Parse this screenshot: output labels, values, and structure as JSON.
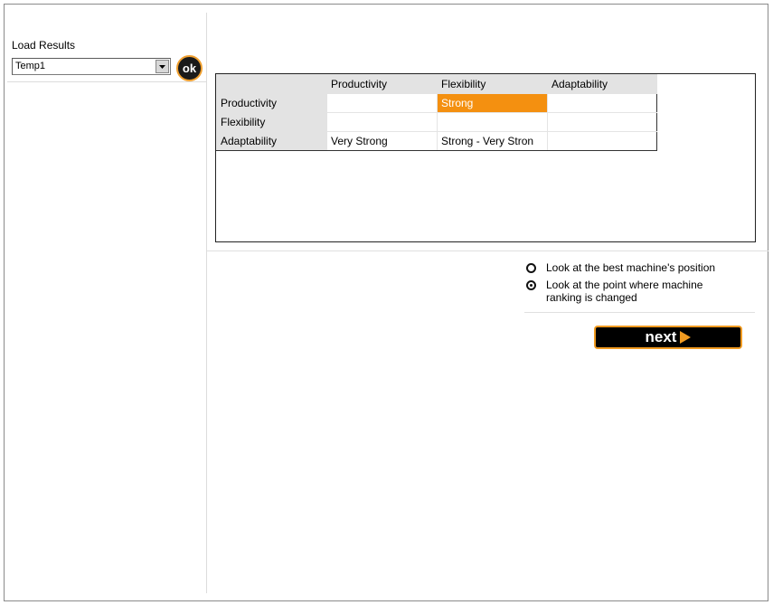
{
  "load": {
    "label": "Load Results",
    "selected": "Temp1",
    "ok_label": "ok"
  },
  "matrix": {
    "columns": [
      "",
      "Productivity",
      "Flexibility",
      "Adaptability"
    ],
    "rows": [
      {
        "label": "Productivity",
        "cells": [
          "",
          "Strong",
          ""
        ]
      },
      {
        "label": "Flexibility",
        "cells": [
          "",
          "",
          ""
        ]
      },
      {
        "label": "Adaptability",
        "cells": [
          "Very Strong",
          "Strong - Very Stron",
          ""
        ]
      }
    ],
    "highlight_color": "#f49010"
  },
  "options": {
    "items": [
      {
        "label": "Look at the best machine's position",
        "checked": false
      },
      {
        "label": "Look at the point where machine ranking is changed",
        "checked": true
      }
    ]
  },
  "next": {
    "label": "next"
  },
  "colors": {
    "accent": "#f09a20",
    "button_bg": "#000000"
  }
}
